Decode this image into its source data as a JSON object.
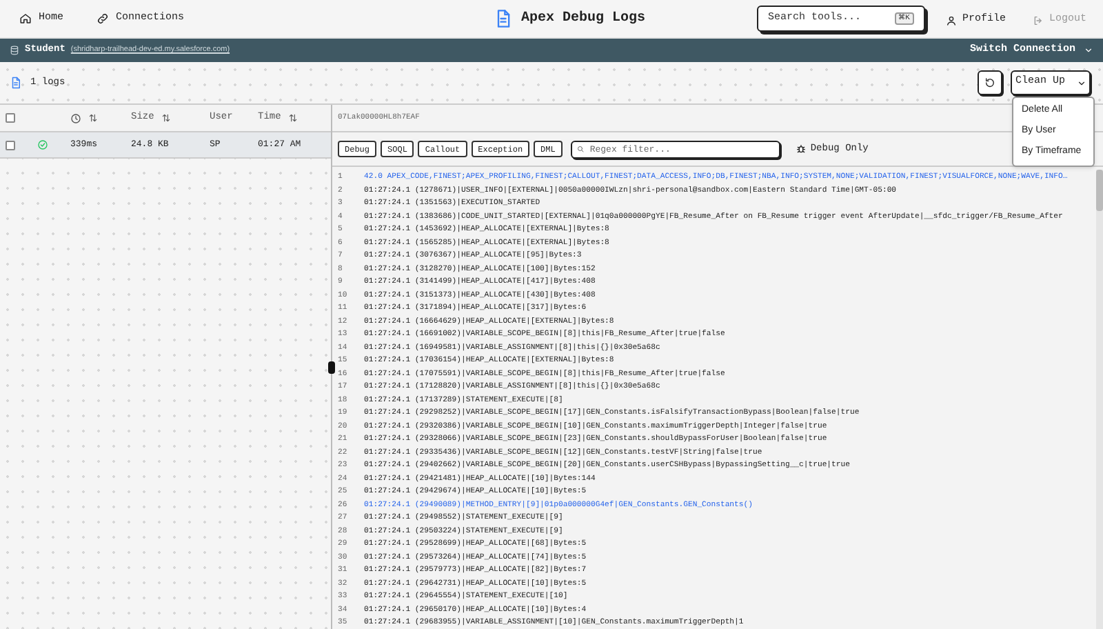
{
  "nav": {
    "items": [
      {
        "label": "Home"
      },
      {
        "label": "Connections"
      }
    ],
    "title": "Apex Debug Logs",
    "search": {
      "placeholder": "Search tools...",
      "shortcut": "⌘K"
    },
    "profile": "Profile",
    "logout": "Logout"
  },
  "connection": {
    "name": "Student",
    "url": "(shridharp-trailhead-dev-ed.my.salesforce.com)",
    "switch": "Switch Connection"
  },
  "toolbar": {
    "count": "1 logs",
    "cleanup": "Clean Up",
    "menu": [
      "Delete All",
      "By User",
      "By Timeframe"
    ]
  },
  "table": {
    "all_checked": false,
    "columns": [
      {
        "sortable": true
      },
      {
        "label": "Size",
        "sortable": true
      },
      {
        "label": "User",
        "sortable": false
      },
      {
        "label": "Time",
        "sortable": true
      }
    ],
    "rows": [
      {
        "selected": true,
        "checked": false,
        "succeeded": true,
        "duration": "339ms",
        "size": "24.8 KB",
        "user": "SP",
        "time": "01:27 AM"
      }
    ]
  },
  "viewer": {
    "log_id": "07Lak00000HL8h7EAF",
    "filters": [
      "Debug",
      "SOQL",
      "Callout",
      "Exception",
      "DML"
    ],
    "regex_placeholder": "Regex filter...",
    "debug_only": {
      "label": "Debug Only",
      "checked": false
    },
    "lines": [
      {
        "n": "1",
        "text": "42.0 APEX_CODE,FINEST;APEX_PROFILING,FINEST;CALLOUT,FINEST;DATA_ACCESS,INFO;DB,FINEST;NBA,INFO;SYSTEM,NONE;VALIDATION,FINEST;VISUALFORCE,NONE;WAVE,INFO…",
        "highlighted": true
      },
      {
        "n": "2",
        "text": "01:27:24.1 (1278671)|USER_INFO|[EXTERNAL]|0050a00000IWLzn|shri-personal@sandbox.com|Eastern Standard Time|GMT-05:00",
        "highlighted": false
      },
      {
        "n": "3",
        "text": "01:27:24.1 (1351563)|EXECUTION_STARTED",
        "highlighted": false
      },
      {
        "n": "4",
        "text": "01:27:24.1 (1383686)|CODE_UNIT_STARTED|[EXTERNAL]|01q0a000000PgYE|FB_Resume_After on FB_Resume trigger event AfterUpdate|__sfdc_trigger/FB_Resume_After",
        "highlighted": false
      },
      {
        "n": "5",
        "text": "01:27:24.1 (1453692)|HEAP_ALLOCATE|[EXTERNAL]|Bytes:8",
        "highlighted": false
      },
      {
        "n": "6",
        "text": "01:27:24.1 (1565285)|HEAP_ALLOCATE|[EXTERNAL]|Bytes:8",
        "highlighted": false
      },
      {
        "n": "7",
        "text": "01:27:24.1 (3076367)|HEAP_ALLOCATE|[95]|Bytes:3",
        "highlighted": false
      },
      {
        "n": "8",
        "text": "01:27:24.1 (3128270)|HEAP_ALLOCATE|[100]|Bytes:152",
        "highlighted": false
      },
      {
        "n": "9",
        "text": "01:27:24.1 (3141499)|HEAP_ALLOCATE|[417]|Bytes:408",
        "highlighted": false
      },
      {
        "n": "10",
        "text": "01:27:24.1 (3151373)|HEAP_ALLOCATE|[430]|Bytes:408",
        "highlighted": false
      },
      {
        "n": "11",
        "text": "01:27:24.1 (3171894)|HEAP_ALLOCATE|[317]|Bytes:6",
        "highlighted": false
      },
      {
        "n": "12",
        "text": "01:27:24.1 (16664629)|HEAP_ALLOCATE|[EXTERNAL]|Bytes:8",
        "highlighted": false
      },
      {
        "n": "13",
        "text": "01:27:24.1 (16691002)|VARIABLE_SCOPE_BEGIN|[8]|this|FB_Resume_After|true|false",
        "highlighted": false
      },
      {
        "n": "14",
        "text": "01:27:24.1 (16949581)|VARIABLE_ASSIGNMENT|[8]|this|{}|0x30e5a68c",
        "highlighted": false
      },
      {
        "n": "15",
        "text": "01:27:24.1 (17036154)|HEAP_ALLOCATE|[EXTERNAL]|Bytes:8",
        "highlighted": false
      },
      {
        "n": "16",
        "text": "01:27:24.1 (17075591)|VARIABLE_SCOPE_BEGIN|[8]|this|FB_Resume_After|true|false",
        "highlighted": false
      },
      {
        "n": "17",
        "text": "01:27:24.1 (17128820)|VARIABLE_ASSIGNMENT|[8]|this|{}|0x30e5a68c",
        "highlighted": false
      },
      {
        "n": "18",
        "text": "01:27:24.1 (17137289)|STATEMENT_EXECUTE|[8]",
        "highlighted": false
      },
      {
        "n": "19",
        "text": "01:27:24.1 (29298252)|VARIABLE_SCOPE_BEGIN|[17]|GEN_Constants.isFalsifyTransactionBypass|Boolean|false|true",
        "highlighted": false
      },
      {
        "n": "20",
        "text": "01:27:24.1 (29320386)|VARIABLE_SCOPE_BEGIN|[10]|GEN_Constants.maximumTriggerDepth|Integer|false|true",
        "highlighted": false
      },
      {
        "n": "21",
        "text": "01:27:24.1 (29328066)|VARIABLE_SCOPE_BEGIN|[23]|GEN_Constants.shouldBypassForUser|Boolean|false|true",
        "highlighted": false
      },
      {
        "n": "22",
        "text": "01:27:24.1 (29335436)|VARIABLE_SCOPE_BEGIN|[12]|GEN_Constants.testVF|String|false|true",
        "highlighted": false
      },
      {
        "n": "23",
        "text": "01:27:24.1 (29402662)|VARIABLE_SCOPE_BEGIN|[20]|GEN_Constants.userCSHBypass|BypassingSetting__c|true|true",
        "highlighted": false
      },
      {
        "n": "24",
        "text": "01:27:24.1 (29421481)|HEAP_ALLOCATE|[10]|Bytes:144",
        "highlighted": false
      },
      {
        "n": "25",
        "text": "01:27:24.1 (29429674)|HEAP_ALLOCATE|[10]|Bytes:5",
        "highlighted": false
      },
      {
        "n": "26",
        "text": "01:27:24.1 (29490089)|METHOD_ENTRY|[9]|01p0a000000G4ef|GEN_Constants.GEN_Constants()",
        "highlighted": true
      },
      {
        "n": "27",
        "text": "01:27:24.1 (29498552)|STATEMENT_EXECUTE|[9]",
        "highlighted": false
      },
      {
        "n": "28",
        "text": "01:27:24.1 (29503224)|STATEMENT_EXECUTE|[9]",
        "highlighted": false
      },
      {
        "n": "29",
        "text": "01:27:24.1 (29528699)|HEAP_ALLOCATE|[68]|Bytes:5",
        "highlighted": false
      },
      {
        "n": "30",
        "text": "01:27:24.1 (29573264)|HEAP_ALLOCATE|[74]|Bytes:5",
        "highlighted": false
      },
      {
        "n": "31",
        "text": "01:27:24.1 (29579773)|HEAP_ALLOCATE|[82]|Bytes:7",
        "highlighted": false
      },
      {
        "n": "32",
        "text": "01:27:24.1 (29642731)|HEAP_ALLOCATE|[10]|Bytes:5",
        "highlighted": false
      },
      {
        "n": "33",
        "text": "01:27:24.1 (29645554)|STATEMENT_EXECUTE|[10]",
        "highlighted": false
      },
      {
        "n": "34",
        "text": "01:27:24.1 (29650170)|HEAP_ALLOCATE|[10]|Bytes:4",
        "highlighted": false
      },
      {
        "n": "35",
        "text": "01:27:24.1 (29683955)|VARIABLE_ASSIGNMENT|[10]|GEN_Constants.maximumTriggerDepth|1",
        "highlighted": false
      }
    ]
  }
}
